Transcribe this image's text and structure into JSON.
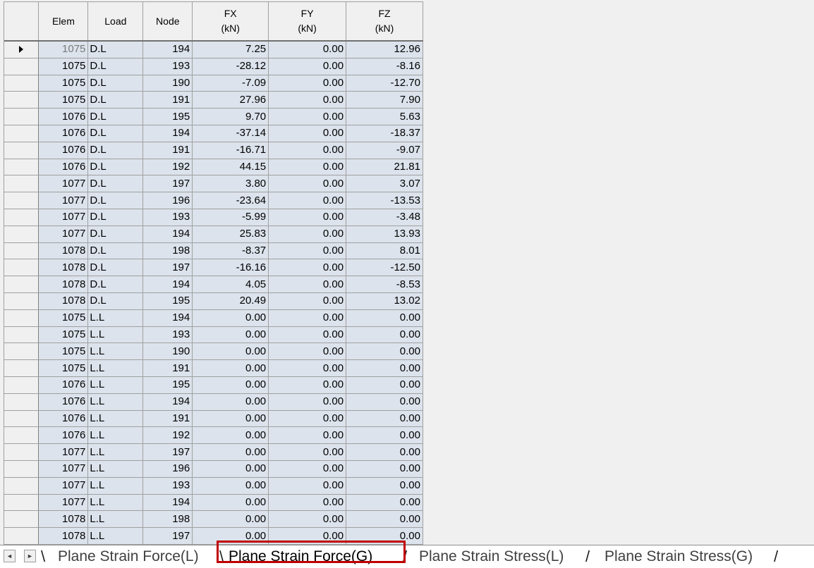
{
  "table": {
    "headers": {
      "elem": "Elem",
      "load": "Load",
      "node": "Node",
      "fx": [
        "FX",
        "(kN)"
      ],
      "fy": [
        "FY",
        "(kN)"
      ],
      "fz": [
        "FZ",
        "(kN)"
      ]
    },
    "rows": [
      [
        "1075",
        "D.L",
        "194",
        "7.25",
        "0.00",
        "12.96"
      ],
      [
        "1075",
        "D.L",
        "193",
        "-28.12",
        "0.00",
        "-8.16"
      ],
      [
        "1075",
        "D.L",
        "190",
        "-7.09",
        "0.00",
        "-12.70"
      ],
      [
        "1075",
        "D.L",
        "191",
        "27.96",
        "0.00",
        "7.90"
      ],
      [
        "1076",
        "D.L",
        "195",
        "9.70",
        "0.00",
        "5.63"
      ],
      [
        "1076",
        "D.L",
        "194",
        "-37.14",
        "0.00",
        "-18.37"
      ],
      [
        "1076",
        "D.L",
        "191",
        "-16.71",
        "0.00",
        "-9.07"
      ],
      [
        "1076",
        "D.L",
        "192",
        "44.15",
        "0.00",
        "21.81"
      ],
      [
        "1077",
        "D.L",
        "197",
        "3.80",
        "0.00",
        "3.07"
      ],
      [
        "1077",
        "D.L",
        "196",
        "-23.64",
        "0.00",
        "-13.53"
      ],
      [
        "1077",
        "D.L",
        "193",
        "-5.99",
        "0.00",
        "-3.48"
      ],
      [
        "1077",
        "D.L",
        "194",
        "25.83",
        "0.00",
        "13.93"
      ],
      [
        "1078",
        "D.L",
        "198",
        "-8.37",
        "0.00",
        "8.01"
      ],
      [
        "1078",
        "D.L",
        "197",
        "-16.16",
        "0.00",
        "-12.50"
      ],
      [
        "1078",
        "D.L",
        "194",
        "4.05",
        "0.00",
        "-8.53"
      ],
      [
        "1078",
        "D.L",
        "195",
        "20.49",
        "0.00",
        "13.02"
      ],
      [
        "1075",
        "L.L",
        "194",
        "0.00",
        "0.00",
        "0.00"
      ],
      [
        "1075",
        "L.L",
        "193",
        "0.00",
        "0.00",
        "0.00"
      ],
      [
        "1075",
        "L.L",
        "190",
        "0.00",
        "0.00",
        "0.00"
      ],
      [
        "1075",
        "L.L",
        "191",
        "0.00",
        "0.00",
        "0.00"
      ],
      [
        "1076",
        "L.L",
        "195",
        "0.00",
        "0.00",
        "0.00"
      ],
      [
        "1076",
        "L.L",
        "194",
        "0.00",
        "0.00",
        "0.00"
      ],
      [
        "1076",
        "L.L",
        "191",
        "0.00",
        "0.00",
        "0.00"
      ],
      [
        "1076",
        "L.L",
        "192",
        "0.00",
        "0.00",
        "0.00"
      ],
      [
        "1077",
        "L.L",
        "197",
        "0.00",
        "0.00",
        "0.00"
      ],
      [
        "1077",
        "L.L",
        "196",
        "0.00",
        "0.00",
        "0.00"
      ],
      [
        "1077",
        "L.L",
        "193",
        "0.00",
        "0.00",
        "0.00"
      ],
      [
        "1077",
        "L.L",
        "194",
        "0.00",
        "0.00",
        "0.00"
      ],
      [
        "1078",
        "L.L",
        "198",
        "0.00",
        "0.00",
        "0.00"
      ],
      [
        "1078",
        "L.L",
        "197",
        "0.00",
        "0.00",
        "0.00"
      ]
    ]
  },
  "tabs": [
    {
      "label": "Plane Strain Force(L)",
      "active": false
    },
    {
      "label": "Plane Strain Force(G)",
      "active": true
    },
    {
      "label": "Plane Strain Stress(L)",
      "active": false
    },
    {
      "label": "Plane Strain Stress(G)",
      "active": false
    }
  ],
  "nav": {
    "prev_icon": "◄",
    "next_icon": "►"
  },
  "colors": {
    "cell_background": "#dce3ec",
    "header_background": "#f0f0f0",
    "active_tab_highlight": "#c00000"
  }
}
